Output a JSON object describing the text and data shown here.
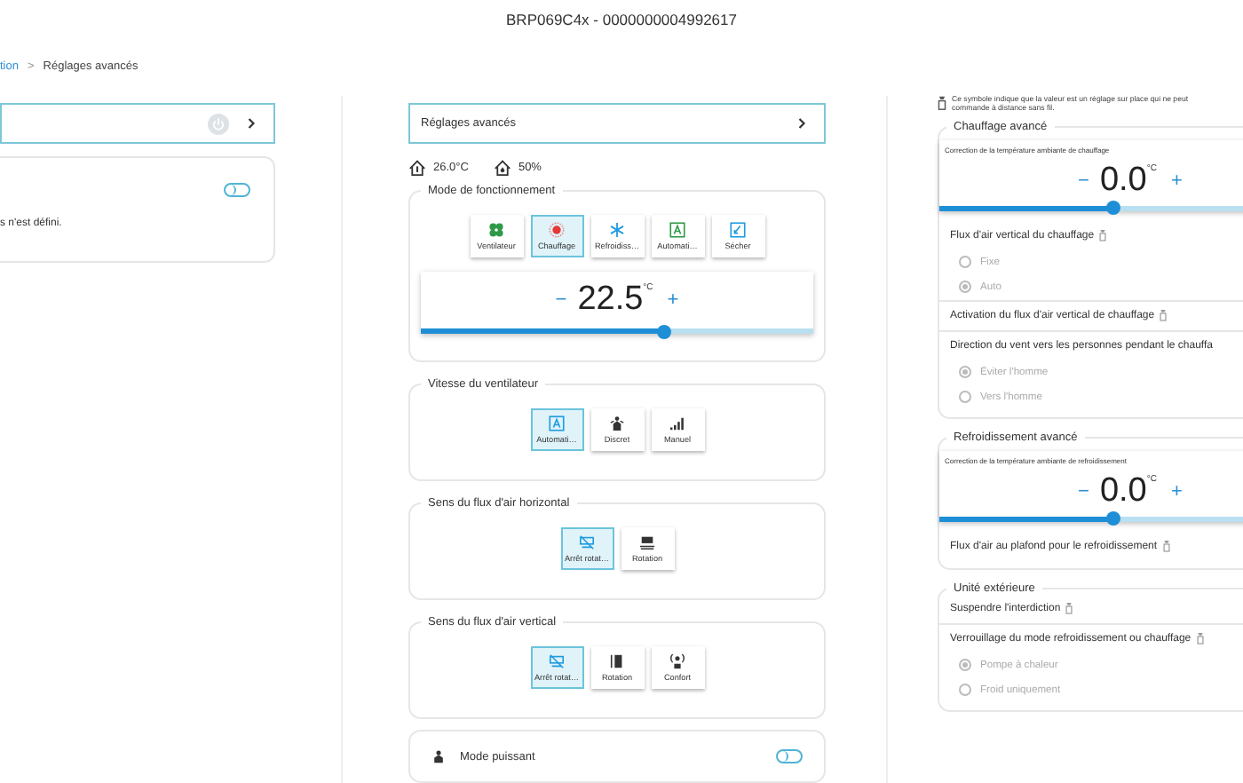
{
  "header": {
    "title": "BRP069C4x - 0000000004992617"
  },
  "breadcrumb": {
    "separator": ">",
    "items": [
      {
        "label": "tion",
        "current": false
      },
      {
        "label": "Réglages avancés",
        "current": true
      }
    ]
  },
  "left": {
    "nav": {
      "power_disabled": true
    },
    "card": {
      "toggle_on": false,
      "text": "s n'est défini."
    }
  },
  "middle": {
    "nav": {
      "label": "Réglages avancés"
    },
    "readings": [
      {
        "kind": "temperature",
        "value": "26.0°C"
      },
      {
        "kind": "humidity",
        "value": "50%"
      }
    ],
    "sections": [
      {
        "title": "Mode de fonctionnement",
        "options": [
          {
            "kind": "fan",
            "label": "Ventilateur",
            "selected": false
          },
          {
            "kind": "heat",
            "label": "Chauffage",
            "selected": true
          },
          {
            "kind": "cool",
            "label": "Refroidiss…",
            "selected": false
          },
          {
            "kind": "auto",
            "label": "Automati…",
            "selected": false
          },
          {
            "kind": "dry",
            "label": "Sécher",
            "selected": false
          }
        ],
        "setpoint": {
          "minus": "−",
          "value": "22.5",
          "unit": "°C",
          "plus": "+",
          "level": 0.62
        }
      },
      {
        "title": "Vitesse du ventilateur",
        "options": [
          {
            "kind": "fan-auto",
            "label": "Automati…",
            "selected": true
          },
          {
            "kind": "quiet",
            "label": "Discret",
            "selected": false
          },
          {
            "kind": "bars",
            "label": "Manuel",
            "selected": false
          }
        ]
      },
      {
        "title": "Sens du flux d'air horizontal",
        "options": [
          {
            "kind": "swing-stop",
            "label": "Arrêt rotat…",
            "selected": true
          },
          {
            "kind": "swing-h",
            "label": "Rotation",
            "selected": false
          }
        ]
      },
      {
        "title": "Sens du flux d'air vertical",
        "options": [
          {
            "kind": "swing-stop",
            "label": "Arrêt rotat…",
            "selected": true
          },
          {
            "kind": "swing-v",
            "label": "Rotation",
            "selected": false
          },
          {
            "kind": "comfort",
            "label": "Confort",
            "selected": false
          }
        ]
      }
    ],
    "power_mode": {
      "label": "Mode puissant",
      "on": false
    }
  },
  "right": {
    "note": {
      "lines": [
        "Ce symbole indique que la valeur est un réglage sur place qui ne peut",
        "commande à distance sans fil."
      ]
    },
    "groups": [
      {
        "title": "Chauffage avancé",
        "items": [
          {
            "kind": "setpoint",
            "label": "Correction de la température ambiante de chauffage",
            "minus": "−",
            "value": "0.0",
            "unit": "°C",
            "plus": "+",
            "level": 0.55
          },
          {
            "kind": "radio",
            "label": "Flux d'air vertical du chauffage",
            "locked": true,
            "disabled": true,
            "options": [
              {
                "label": "Fixe",
                "selected": false
              },
              {
                "label": "Auto",
                "selected": true
              }
            ]
          },
          {
            "kind": "setting",
            "label": "Activation du flux d'air vertical de chauffage",
            "locked": true
          },
          {
            "kind": "radio",
            "label": "Direction du vent vers les personnes pendant le chauffa",
            "locked": false,
            "disabled": true,
            "options": [
              {
                "label": "Éviter l'homme",
                "selected": true
              },
              {
                "label": "Vers l'homme",
                "selected": false
              }
            ]
          }
        ]
      },
      {
        "title": "Refroidissement avancé",
        "items": [
          {
            "kind": "setpoint",
            "label": "Correction de la température ambiante de refroidissement",
            "minus": "−",
            "value": "0.0",
            "unit": "°C",
            "plus": "+",
            "level": 0.55
          },
          {
            "kind": "setting",
            "label": "Flux d'air au plafond pour le refroidissement",
            "locked": true
          }
        ]
      },
      {
        "title": "Unité extérieure",
        "items": [
          {
            "kind": "setting",
            "label": "Suspendre l'interdiction",
            "locked": true
          },
          {
            "kind": "radio",
            "label": "Verrouillage du mode refroidissement ou chauffage",
            "locked": true,
            "disabled": true,
            "options": [
              {
                "label": "Pompe à chaleur",
                "selected": true
              },
              {
                "label": "Froid uniquement",
                "selected": false
              }
            ]
          }
        ]
      }
    ]
  }
}
